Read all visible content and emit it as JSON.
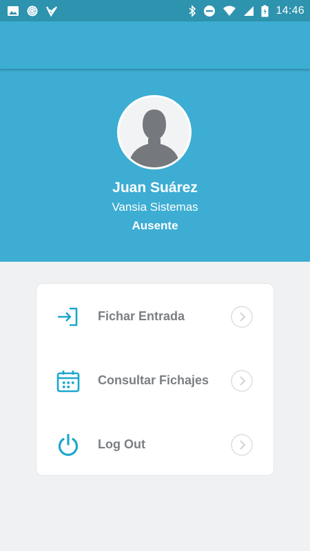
{
  "status_bar": {
    "time": "14:46",
    "left_icons": [
      "image-icon",
      "sync-icon",
      "app-check-icon"
    ],
    "right_icons": [
      "bluetooth-icon",
      "do-not-disturb-icon",
      "wifi-icon",
      "signal-icon",
      "battery-icon"
    ]
  },
  "colors": {
    "status_bar": "#2e93ae",
    "primary": "#3dadd3",
    "background": "#f0f1f3",
    "card": "#ffffff",
    "icon_accent": "#1ba7cf",
    "menu_text": "#7b7e82"
  },
  "profile": {
    "name": "Juan Suárez",
    "company": "Vansia Sistemas",
    "status": "Ausente",
    "avatar_icon": "user-silhouette-icon"
  },
  "menu": {
    "items": [
      {
        "label": "Fichar Entrada",
        "icon": "sign-in-icon"
      },
      {
        "label": "Consultar Fichajes",
        "icon": "calendar-icon"
      },
      {
        "label": "Log Out",
        "icon": "power-icon"
      }
    ]
  }
}
